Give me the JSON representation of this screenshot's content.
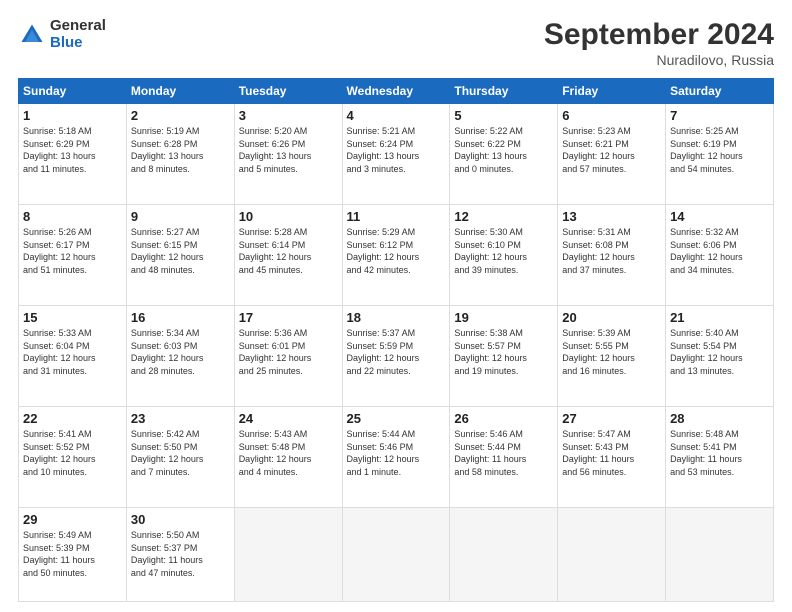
{
  "logo": {
    "general": "General",
    "blue": "Blue"
  },
  "header": {
    "month": "September 2024",
    "location": "Nuradilovo, Russia"
  },
  "weekdays": [
    "Sunday",
    "Monday",
    "Tuesday",
    "Wednesday",
    "Thursday",
    "Friday",
    "Saturday"
  ],
  "weeks": [
    [
      {
        "day": "1",
        "info": "Sunrise: 5:18 AM\nSunset: 6:29 PM\nDaylight: 13 hours\nand 11 minutes."
      },
      {
        "day": "2",
        "info": "Sunrise: 5:19 AM\nSunset: 6:28 PM\nDaylight: 13 hours\nand 8 minutes."
      },
      {
        "day": "3",
        "info": "Sunrise: 5:20 AM\nSunset: 6:26 PM\nDaylight: 13 hours\nand 5 minutes."
      },
      {
        "day": "4",
        "info": "Sunrise: 5:21 AM\nSunset: 6:24 PM\nDaylight: 13 hours\nand 3 minutes."
      },
      {
        "day": "5",
        "info": "Sunrise: 5:22 AM\nSunset: 6:22 PM\nDaylight: 13 hours\nand 0 minutes."
      },
      {
        "day": "6",
        "info": "Sunrise: 5:23 AM\nSunset: 6:21 PM\nDaylight: 12 hours\nand 57 minutes."
      },
      {
        "day": "7",
        "info": "Sunrise: 5:25 AM\nSunset: 6:19 PM\nDaylight: 12 hours\nand 54 minutes."
      }
    ],
    [
      {
        "day": "8",
        "info": "Sunrise: 5:26 AM\nSunset: 6:17 PM\nDaylight: 12 hours\nand 51 minutes."
      },
      {
        "day": "9",
        "info": "Sunrise: 5:27 AM\nSunset: 6:15 PM\nDaylight: 12 hours\nand 48 minutes."
      },
      {
        "day": "10",
        "info": "Sunrise: 5:28 AM\nSunset: 6:14 PM\nDaylight: 12 hours\nand 45 minutes."
      },
      {
        "day": "11",
        "info": "Sunrise: 5:29 AM\nSunset: 6:12 PM\nDaylight: 12 hours\nand 42 minutes."
      },
      {
        "day": "12",
        "info": "Sunrise: 5:30 AM\nSunset: 6:10 PM\nDaylight: 12 hours\nand 39 minutes."
      },
      {
        "day": "13",
        "info": "Sunrise: 5:31 AM\nSunset: 6:08 PM\nDaylight: 12 hours\nand 37 minutes."
      },
      {
        "day": "14",
        "info": "Sunrise: 5:32 AM\nSunset: 6:06 PM\nDaylight: 12 hours\nand 34 minutes."
      }
    ],
    [
      {
        "day": "15",
        "info": "Sunrise: 5:33 AM\nSunset: 6:04 PM\nDaylight: 12 hours\nand 31 minutes."
      },
      {
        "day": "16",
        "info": "Sunrise: 5:34 AM\nSunset: 6:03 PM\nDaylight: 12 hours\nand 28 minutes."
      },
      {
        "day": "17",
        "info": "Sunrise: 5:36 AM\nSunset: 6:01 PM\nDaylight: 12 hours\nand 25 minutes."
      },
      {
        "day": "18",
        "info": "Sunrise: 5:37 AM\nSunset: 5:59 PM\nDaylight: 12 hours\nand 22 minutes."
      },
      {
        "day": "19",
        "info": "Sunrise: 5:38 AM\nSunset: 5:57 PM\nDaylight: 12 hours\nand 19 minutes."
      },
      {
        "day": "20",
        "info": "Sunrise: 5:39 AM\nSunset: 5:55 PM\nDaylight: 12 hours\nand 16 minutes."
      },
      {
        "day": "21",
        "info": "Sunrise: 5:40 AM\nSunset: 5:54 PM\nDaylight: 12 hours\nand 13 minutes."
      }
    ],
    [
      {
        "day": "22",
        "info": "Sunrise: 5:41 AM\nSunset: 5:52 PM\nDaylight: 12 hours\nand 10 minutes."
      },
      {
        "day": "23",
        "info": "Sunrise: 5:42 AM\nSunset: 5:50 PM\nDaylight: 12 hours\nand 7 minutes."
      },
      {
        "day": "24",
        "info": "Sunrise: 5:43 AM\nSunset: 5:48 PM\nDaylight: 12 hours\nand 4 minutes."
      },
      {
        "day": "25",
        "info": "Sunrise: 5:44 AM\nSunset: 5:46 PM\nDaylight: 12 hours\nand 1 minute."
      },
      {
        "day": "26",
        "info": "Sunrise: 5:46 AM\nSunset: 5:44 PM\nDaylight: 11 hours\nand 58 minutes."
      },
      {
        "day": "27",
        "info": "Sunrise: 5:47 AM\nSunset: 5:43 PM\nDaylight: 11 hours\nand 56 minutes."
      },
      {
        "day": "28",
        "info": "Sunrise: 5:48 AM\nSunset: 5:41 PM\nDaylight: 11 hours\nand 53 minutes."
      }
    ],
    [
      {
        "day": "29",
        "info": "Sunrise: 5:49 AM\nSunset: 5:39 PM\nDaylight: 11 hours\nand 50 minutes."
      },
      {
        "day": "30",
        "info": "Sunrise: 5:50 AM\nSunset: 5:37 PM\nDaylight: 11 hours\nand 47 minutes."
      },
      {
        "day": "",
        "info": ""
      },
      {
        "day": "",
        "info": ""
      },
      {
        "day": "",
        "info": ""
      },
      {
        "day": "",
        "info": ""
      },
      {
        "day": "",
        "info": ""
      }
    ]
  ]
}
